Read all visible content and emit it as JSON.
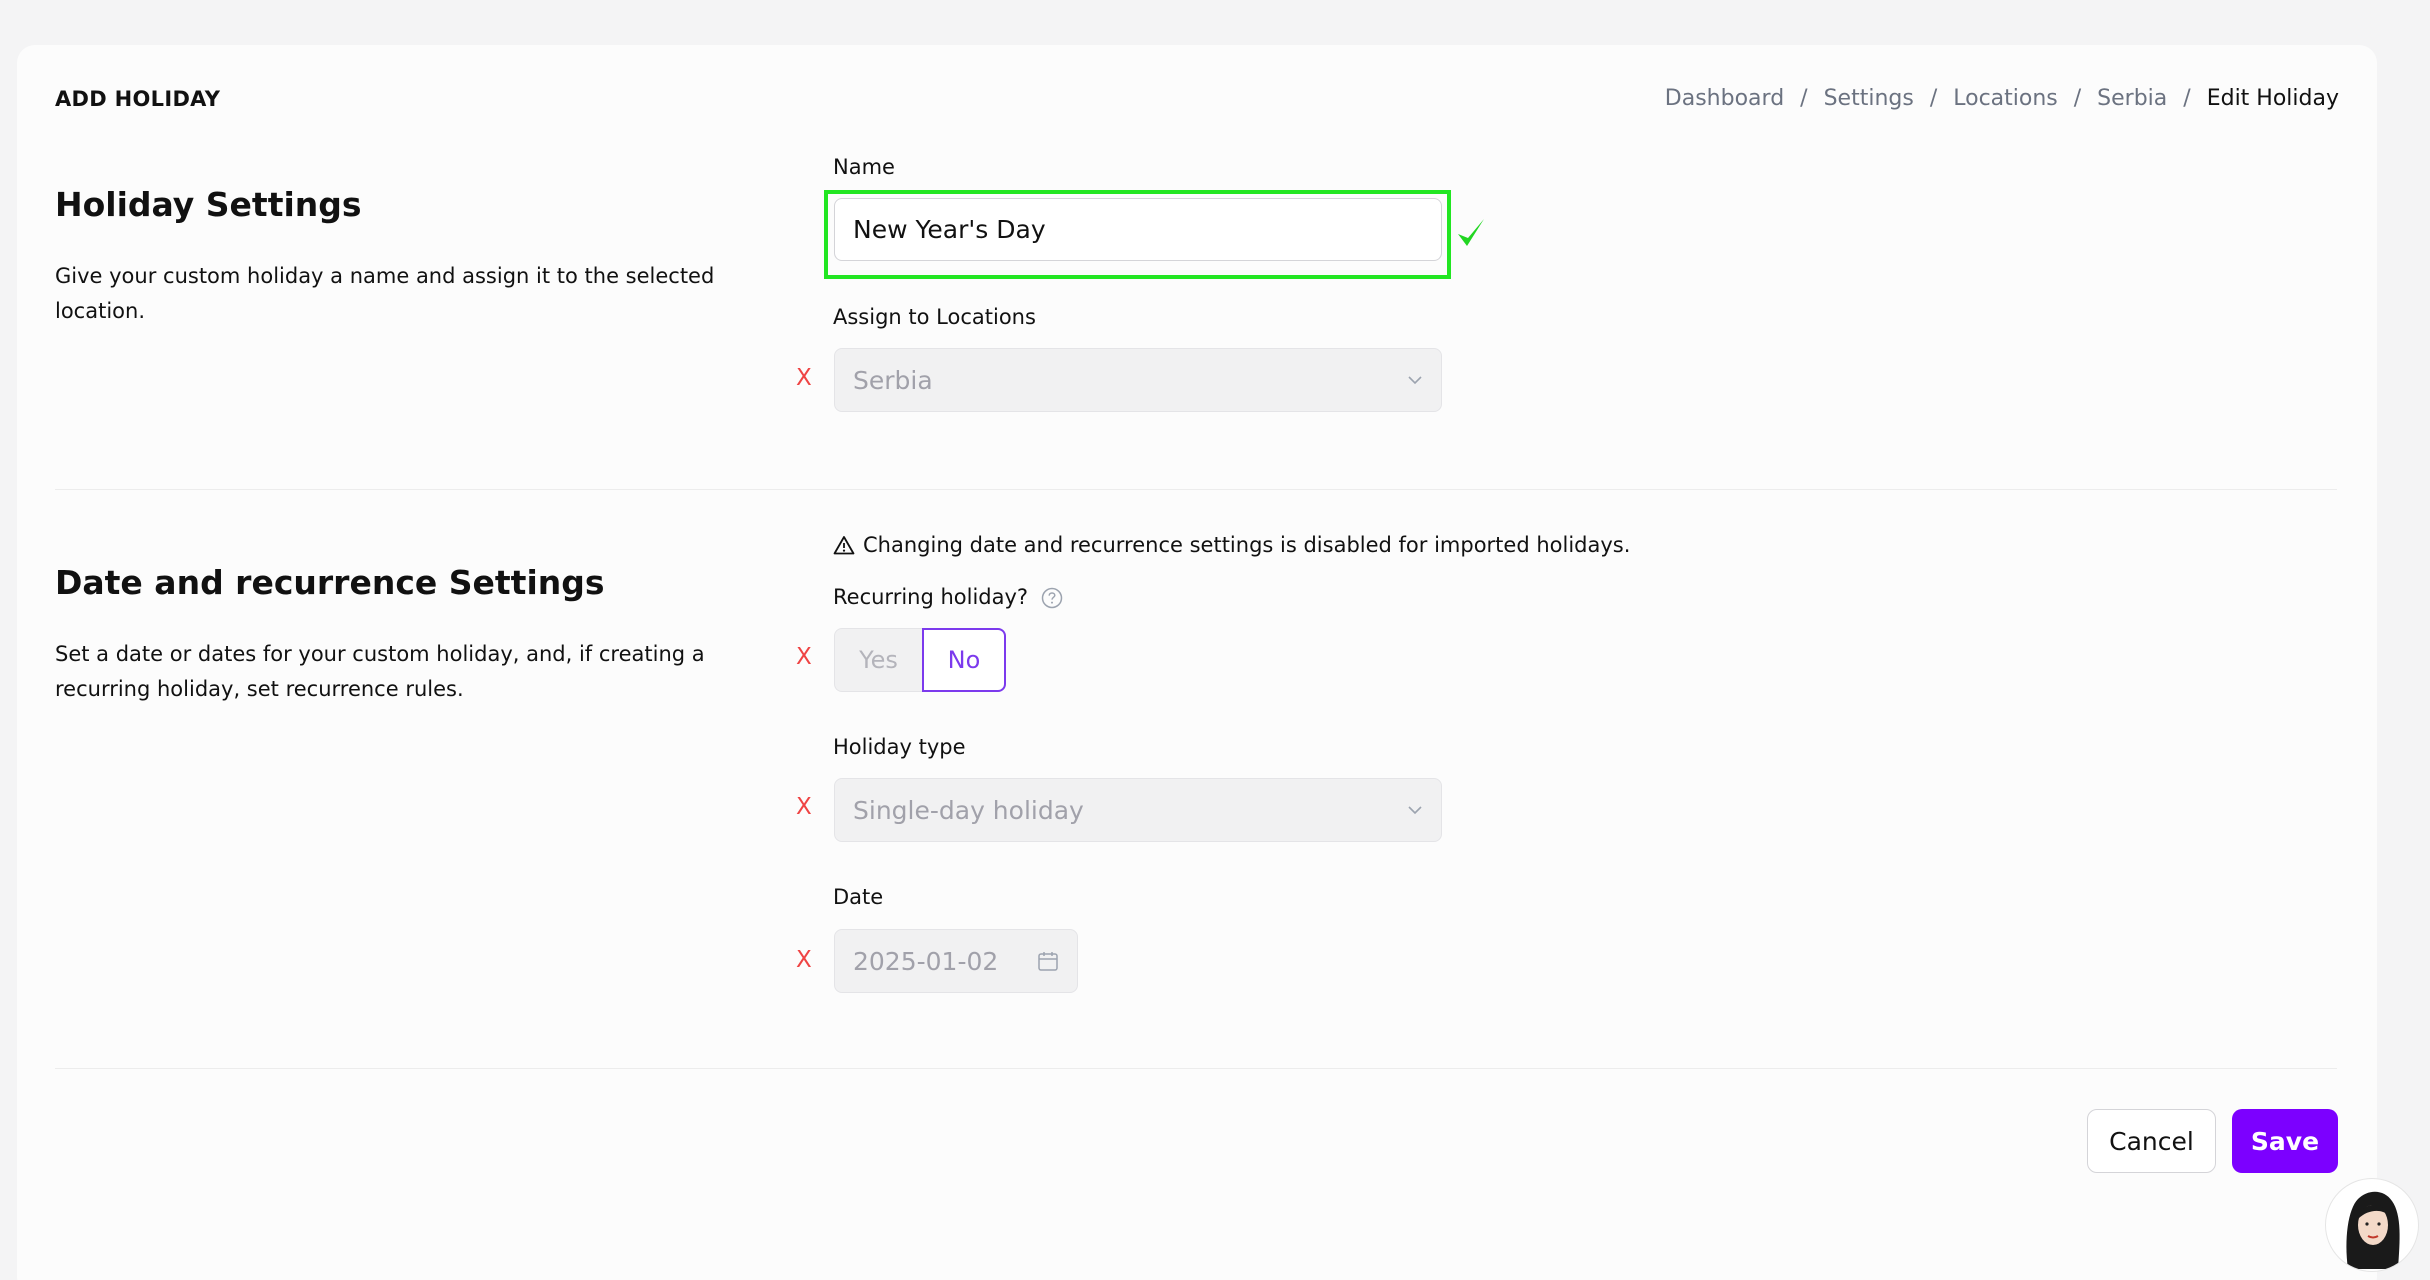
{
  "header": {
    "page_title": "ADD HOLIDAY",
    "breadcrumb": [
      "Dashboard",
      "Settings",
      "Locations",
      "Serbia",
      "Edit Holiday"
    ],
    "separator": "/"
  },
  "holiday_settings": {
    "heading": "Holiday Settings",
    "description": "Give your custom holiday a name and assign it to the selected location.",
    "name_label": "Name",
    "name_value": "New Year's Day",
    "locations_label": "Assign to Locations",
    "locations_value": "Serbia"
  },
  "date_settings": {
    "heading": "Date and recurrence Settings",
    "description": "Set a date or dates for your custom holiday, and, if creating a recurring holiday, set recurrence rules.",
    "warning": "Changing date and recurrence settings is disabled for imported holidays.",
    "recurring_label": "Recurring holiday?",
    "recurring_yes": "Yes",
    "recurring_no": "No",
    "holiday_type_label": "Holiday type",
    "holiday_type_value": "Single-day holiday",
    "date_label": "Date",
    "date_value": "2025-01-02"
  },
  "markers": {
    "disabled_mark": "X"
  },
  "actions": {
    "cancel": "Cancel",
    "save": "Save"
  },
  "colors": {
    "accent": "#7c00ff",
    "highlight": "#22e622",
    "error": "#ef4444"
  }
}
